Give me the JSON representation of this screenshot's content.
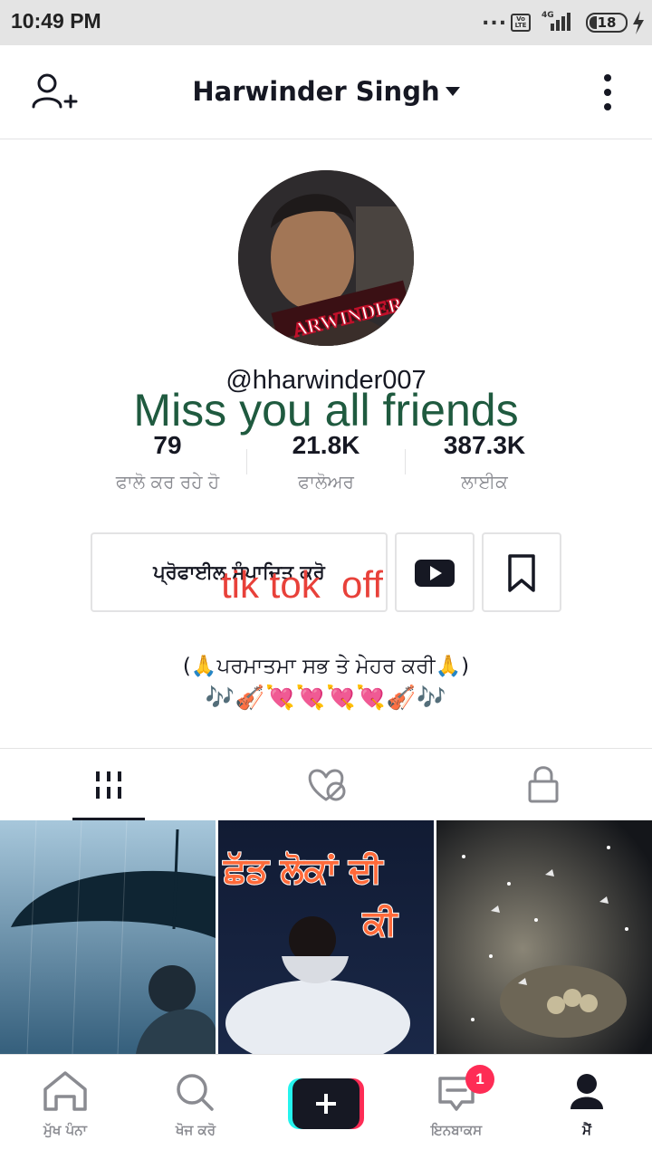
{
  "status_bar": {
    "time": "10:49 PM",
    "dots": "...",
    "volte": "Vo LTE",
    "network": "4G",
    "battery": "18"
  },
  "header": {
    "title": "Harwinder Singh",
    "icons": {
      "left": "add-user-icon",
      "right": "more-vertical-icon"
    }
  },
  "profile": {
    "avatar_caption": "ARWINDER",
    "username": "@hharwinder007",
    "overlay_text": "Miss you all friends",
    "stats": [
      {
        "value": "79",
        "label": "ਫਾਲੋ ਕਰ ਰਹੇ ਹੋ"
      },
      {
        "value": "21.8K",
        "label": "ਫਾਲੋਅਰ"
      },
      {
        "value": "387.3K",
        "label": "ਲਾਈਕ"
      }
    ],
    "edit_profile_label": "ਪ੍ਰੋਫਾਈਲ ਸੰਪਾਦਿਤ ਕਰੋ",
    "overlay_text_2": "tik tok  off",
    "bio_line1": "(🙏ਪਰਮਾਤਮਾ ਸਭ ਤੇ ਮੇਹਰ ਕਰੀ🙏)",
    "bio_line2": "🎶🎻💘💘💘💘🎻🎶"
  },
  "tabs": {
    "items": [
      "videos-grid-icon",
      "liked-hidden-icon",
      "private-lock-icon"
    ],
    "active_index": 0
  },
  "videos": [
    {
      "thumb_text": ""
    },
    {
      "thumb_text_1": "ਛੱਡ ਲੋਕਾਂ ਦੀ",
      "thumb_text_2": "ਕੀ"
    },
    {
      "thumb_text": ""
    }
  ],
  "bottom_nav": {
    "items": [
      {
        "label": "ਮੁੱਖ ਪੰਨਾ",
        "icon": "home-icon"
      },
      {
        "label": "ਖੋਜ ਕਰੋ",
        "icon": "search-icon"
      },
      {
        "label": "",
        "icon": "create-plus-icon"
      },
      {
        "label": "ਇਨਬਾਕਸ",
        "icon": "inbox-icon",
        "badge": "1"
      },
      {
        "label": "ਮੈਂ",
        "icon": "profile-icon"
      }
    ],
    "active_index": 4
  },
  "colors": {
    "accent": "#fe2c55",
    "cyan": "#25f4ee",
    "text_primary": "#161823",
    "text_secondary": "#8a8b91",
    "overlay_green": "#1f5a3f",
    "overlay_red": "#e8413a"
  }
}
